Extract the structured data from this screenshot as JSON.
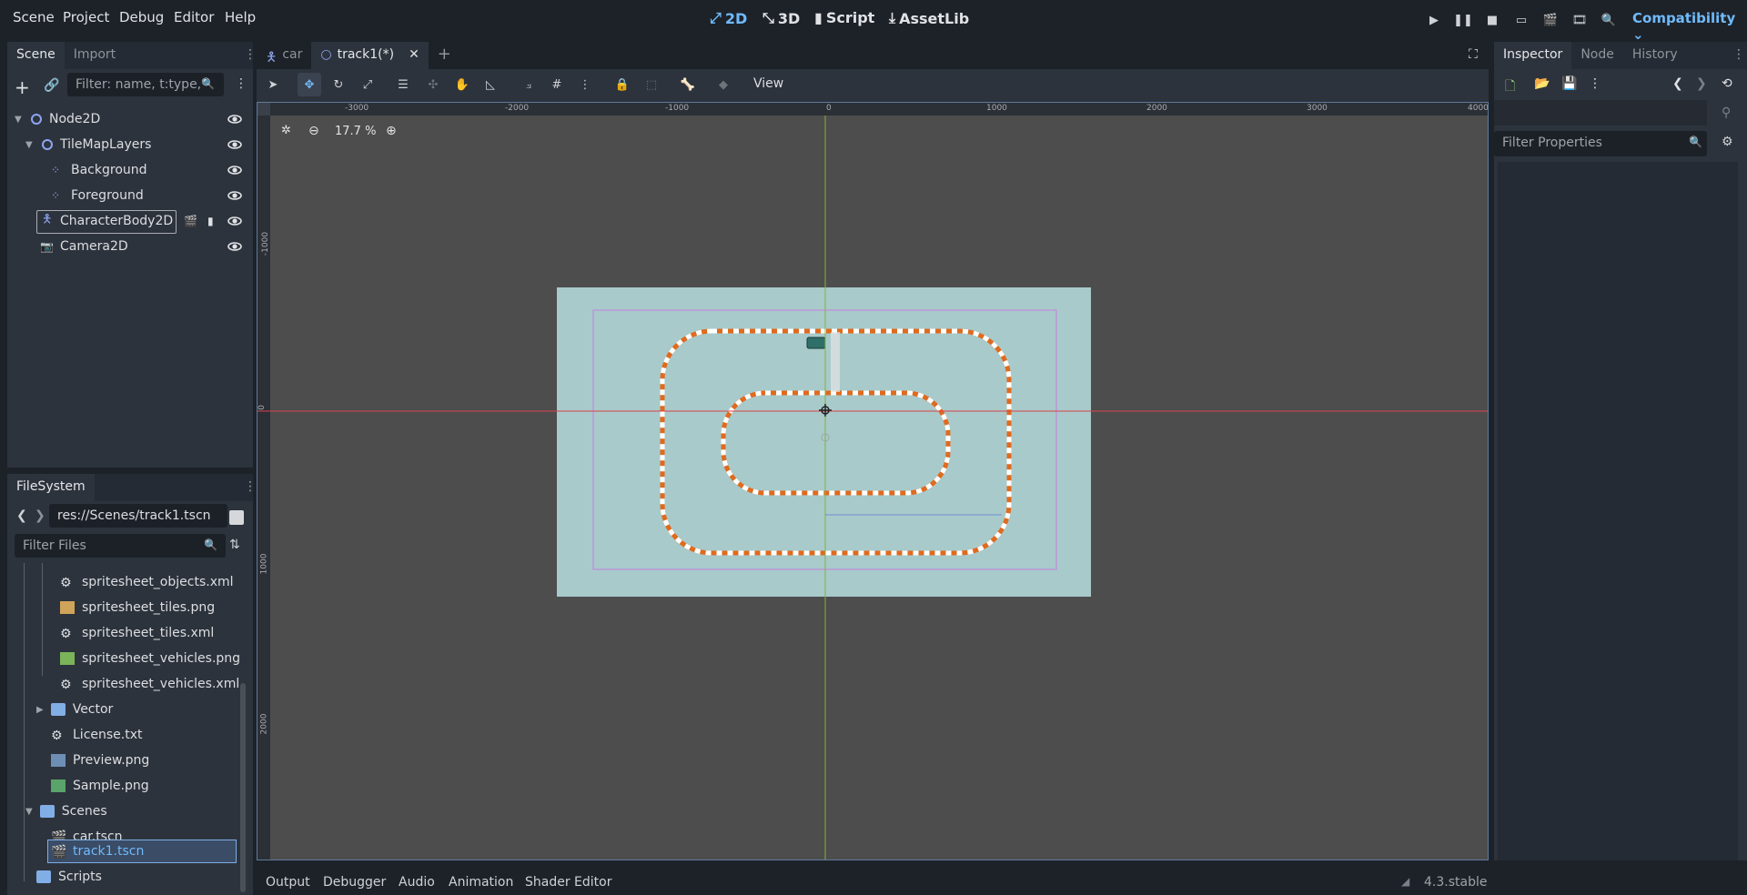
{
  "menu": [
    "Scene",
    "Project",
    "Debug",
    "Editor",
    "Help"
  ],
  "modes": [
    {
      "label": "2D",
      "icon": "2d-icon"
    },
    {
      "label": "3D",
      "icon": "3d-icon"
    },
    {
      "label": "Script",
      "icon": "script-icon"
    },
    {
      "label": "AssetLib",
      "icon": "assetlib-icon"
    }
  ],
  "renderer": "Compatibility",
  "scene_dock": {
    "tabs": [
      "Scene",
      "Import"
    ],
    "filter_placeholder": "Filter: name, t:type,",
    "nodes": [
      {
        "label": "Node2D"
      },
      {
        "label": "TileMapLayers"
      },
      {
        "label": "Background"
      },
      {
        "label": "Foreground"
      },
      {
        "label": "CharacterBody2D"
      },
      {
        "label": "Camera2D"
      }
    ]
  },
  "filesystem": {
    "tab": "FileSystem",
    "path": "res://Scenes/track1.tscn",
    "filter_placeholder": "Filter Files",
    "items": [
      {
        "label": "spritesheet_objects.xml"
      },
      {
        "label": "spritesheet_tiles.png"
      },
      {
        "label": "spritesheet_tiles.xml"
      },
      {
        "label": "spritesheet_vehicles.png"
      },
      {
        "label": "spritesheet_vehicles.xml"
      },
      {
        "label": "Vector"
      },
      {
        "label": "License.txt"
      },
      {
        "label": "Preview.png"
      },
      {
        "label": "Sample.png"
      },
      {
        "label": "Scenes"
      },
      {
        "label": "car.tscn"
      },
      {
        "label": "track1.tscn"
      },
      {
        "label": "Scripts"
      }
    ]
  },
  "editor_tabs": [
    "car",
    "track1(*)"
  ],
  "toolbar": {
    "view_label": "View"
  },
  "viewport": {
    "zoom": "17.7 %",
    "ruler_labels": [
      "-3000",
      "-2000",
      "-1000",
      "0",
      "1000",
      "2000",
      "3000",
      "4000"
    ],
    "vruler_labels": [
      "-1000",
      "0",
      "1000",
      "2000"
    ]
  },
  "inspector": {
    "tabs": [
      "Inspector",
      "Node",
      "History"
    ],
    "filter_placeholder": "Filter Properties"
  },
  "bottom_tabs": [
    "Output",
    "Debugger",
    "Audio",
    "Animation",
    "Shader Editor"
  ],
  "version": "4.3.stable",
  "colors": {
    "accent": "#70bafa",
    "track_orange": "#e06a1e",
    "canvas": "#a8caca",
    "viewport_bg": "#4d4d4d"
  }
}
